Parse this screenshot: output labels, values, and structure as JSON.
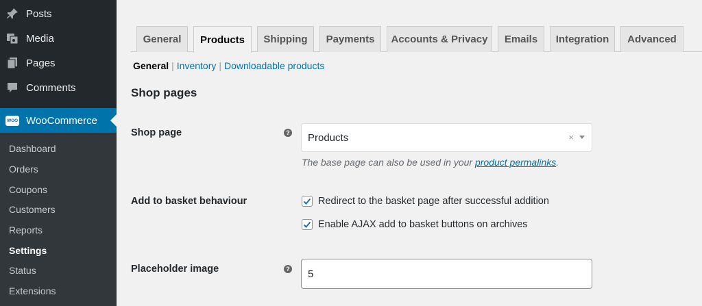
{
  "sidebar": {
    "menu": [
      {
        "label": "Posts",
        "icon": "pin-icon"
      },
      {
        "label": "Media",
        "icon": "media-icon"
      },
      {
        "label": "Pages",
        "icon": "pages-icon"
      },
      {
        "label": "Comments",
        "icon": "comment-icon"
      }
    ],
    "woocommerce": {
      "label": "WooCommerce",
      "badge": "WOO"
    },
    "submenu": [
      "Dashboard",
      "Orders",
      "Coupons",
      "Customers",
      "Reports",
      "Settings",
      "Status",
      "Extensions"
    ],
    "current_submenu": "Settings"
  },
  "tabs": [
    "General",
    "Products",
    "Shipping",
    "Payments",
    "Accounts & Privacy",
    "Emails",
    "Integration",
    "Advanced"
  ],
  "active_tab": "Products",
  "subnav": {
    "current": "General",
    "separator": "|",
    "links": [
      "Inventory",
      "Downloadable products"
    ]
  },
  "section": {
    "title": "Shop pages"
  },
  "shop_page": {
    "label": "Shop page",
    "help": "?",
    "value": "Products",
    "clear": "×",
    "description_prefix": "The base page can also be used in your ",
    "description_link": "product permalinks",
    "description_suffix": "."
  },
  "basket": {
    "label": "Add to basket behaviour",
    "options": [
      {
        "label": "Redirect to the basket page after successful addition",
        "checked": true
      },
      {
        "label": "Enable AJAX add to basket buttons on archives",
        "checked": true
      }
    ]
  },
  "placeholder_image": {
    "label": "Placeholder image",
    "help": "?",
    "value": "5"
  },
  "colors": {
    "sidebar_bg": "#23282d",
    "submenu_bg": "#32373c",
    "accent": "#0073aa",
    "page_bg": "#f1f1f1"
  }
}
